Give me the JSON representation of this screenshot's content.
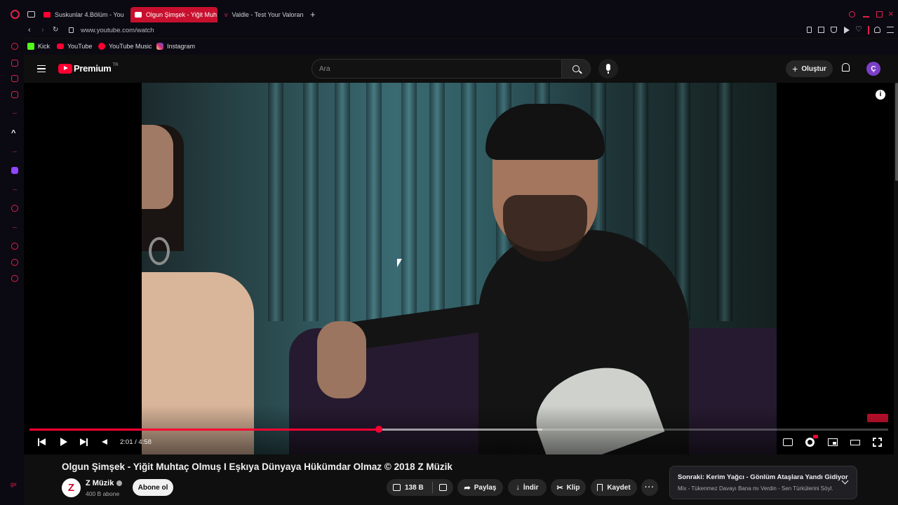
{
  "browser": {
    "tabs": [
      {
        "label": "Suskunlar 4.Bölüm - YouT",
        "active": false
      },
      {
        "label": "Olgun Şimşek - Yiğit Muh",
        "active": true
      },
      {
        "label": "Valdle - Test Your Valoran",
        "active": false
      }
    ],
    "url": "www.youtube.com/watch",
    "bookmarks": [
      {
        "label": "Kick",
        "color": "#53fc18"
      },
      {
        "label": "YouTube",
        "color": "#ff0033"
      },
      {
        "label": "YouTube Music",
        "color": "#ff0033"
      },
      {
        "label": "Instagram",
        "color": "#d62976"
      }
    ],
    "accent": "#e0224a"
  },
  "youtube": {
    "logo_text": "Premium",
    "logo_region": "TR",
    "search_placeholder": "Ara",
    "create_label": "Oluştur",
    "avatar_letter": "Ç"
  },
  "player": {
    "time_current": "2:01",
    "time_total": "4:58",
    "time_text": "2:01 / 4:58",
    "progress_fraction": 0.407,
    "buffer_fraction": 0.597,
    "progress_color": "#ff0033"
  },
  "video": {
    "title": "Olgun Şimşek - Yiğit Muhtaç Olmuş I Eşkıya Dünyaya Hükümdar Olmaz © 2018 Z Müzik",
    "channel_name": "Z Müzik",
    "channel_avatar_letter": "Z",
    "subscribers": "400 B abone",
    "subscribe_label": "Abone ol",
    "like_count": "138 B",
    "share_label": "Paylaş",
    "download_label": "İndir",
    "clip_label": "Klip",
    "save_label": "Kaydet"
  },
  "next_up": {
    "title": "Sonraki: Kerim Yağcı - Gönlüm Ataşlara Yandı Gidiyor",
    "subtitle": "Mix - Tükenmez Davayı Bana mı Verdin - Sen Türkülerini Söyl..."
  }
}
